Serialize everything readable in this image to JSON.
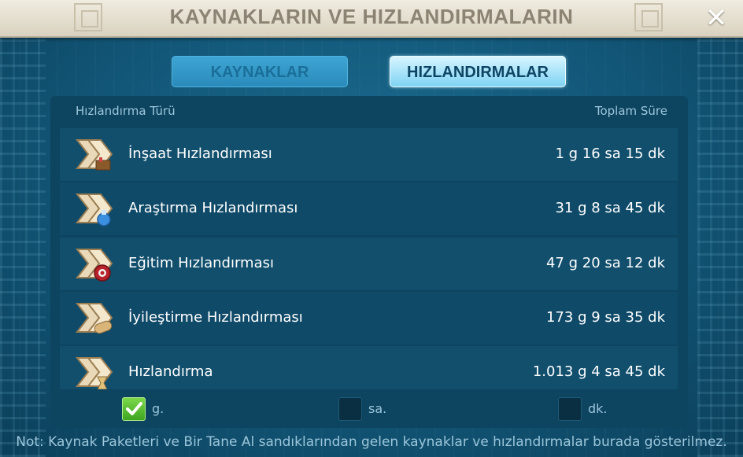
{
  "header": {
    "title": "KAYNAKLARIN VE HIZLANDIRMALARIN",
    "close_symbol": "✕"
  },
  "tabs": [
    {
      "label": "KAYNAKLAR",
      "active": false
    },
    {
      "label": "HIZLANDIRMALAR",
      "active": true
    }
  ],
  "table": {
    "col_type": "Hızlandırma Türü",
    "col_total": "Toplam Süre",
    "rows": [
      {
        "name": "İnşaat Hızlandırması",
        "value": "1 g 16 sa 15 dk",
        "icon": "construction-speedup-icon"
      },
      {
        "name": "Araştırma Hızlandırması",
        "value": "31 g 8 sa 45 dk",
        "icon": "research-speedup-icon"
      },
      {
        "name": "Eğitim Hızlandırması",
        "value": "47 g 20 sa 12 dk",
        "icon": "training-speedup-icon"
      },
      {
        "name": "İyileştirme Hızlandırması",
        "value": "173 g 9 sa 35 dk",
        "icon": "healing-speedup-icon"
      },
      {
        "name": "Hızlandırma",
        "value": "1.013 g 4 sa 45 dk",
        "icon": "universal-speedup-icon"
      }
    ]
  },
  "units": [
    {
      "label": "g.",
      "checked": true
    },
    {
      "label": "sa.",
      "checked": false
    },
    {
      "label": "dk.",
      "checked": false
    }
  ],
  "footnote": "Not: Kaynak Paketleri ve Bir Tane Al sandıklarından gelen kaynaklar ve hızlandırmalar burada gösterilmez.",
  "colors": {
    "accent_active_tab": "#7fd3f3",
    "checkbox_checked": "#3ea521",
    "panel": "#0d4460"
  }
}
